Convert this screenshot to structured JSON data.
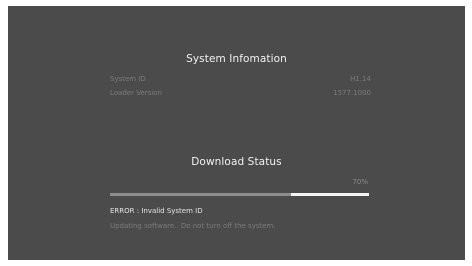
{
  "system_info": {
    "title": "System Infomation",
    "rows": [
      {
        "label": "System ID",
        "value": "H1.14"
      },
      {
        "label": "Loader Version",
        "value": "1577.1000"
      }
    ]
  },
  "download": {
    "title": "Download Status",
    "percent_label": "70%",
    "progress_fraction": 0.7,
    "error_text": "ERROR : Invalid System ID",
    "message_text": "Updating software.. Do not turn off the system."
  },
  "colors": {
    "screen_bg": "#4b4b4b",
    "bar_fill": "#8d8d8d",
    "bar_remaining": "#f3f3f3"
  }
}
